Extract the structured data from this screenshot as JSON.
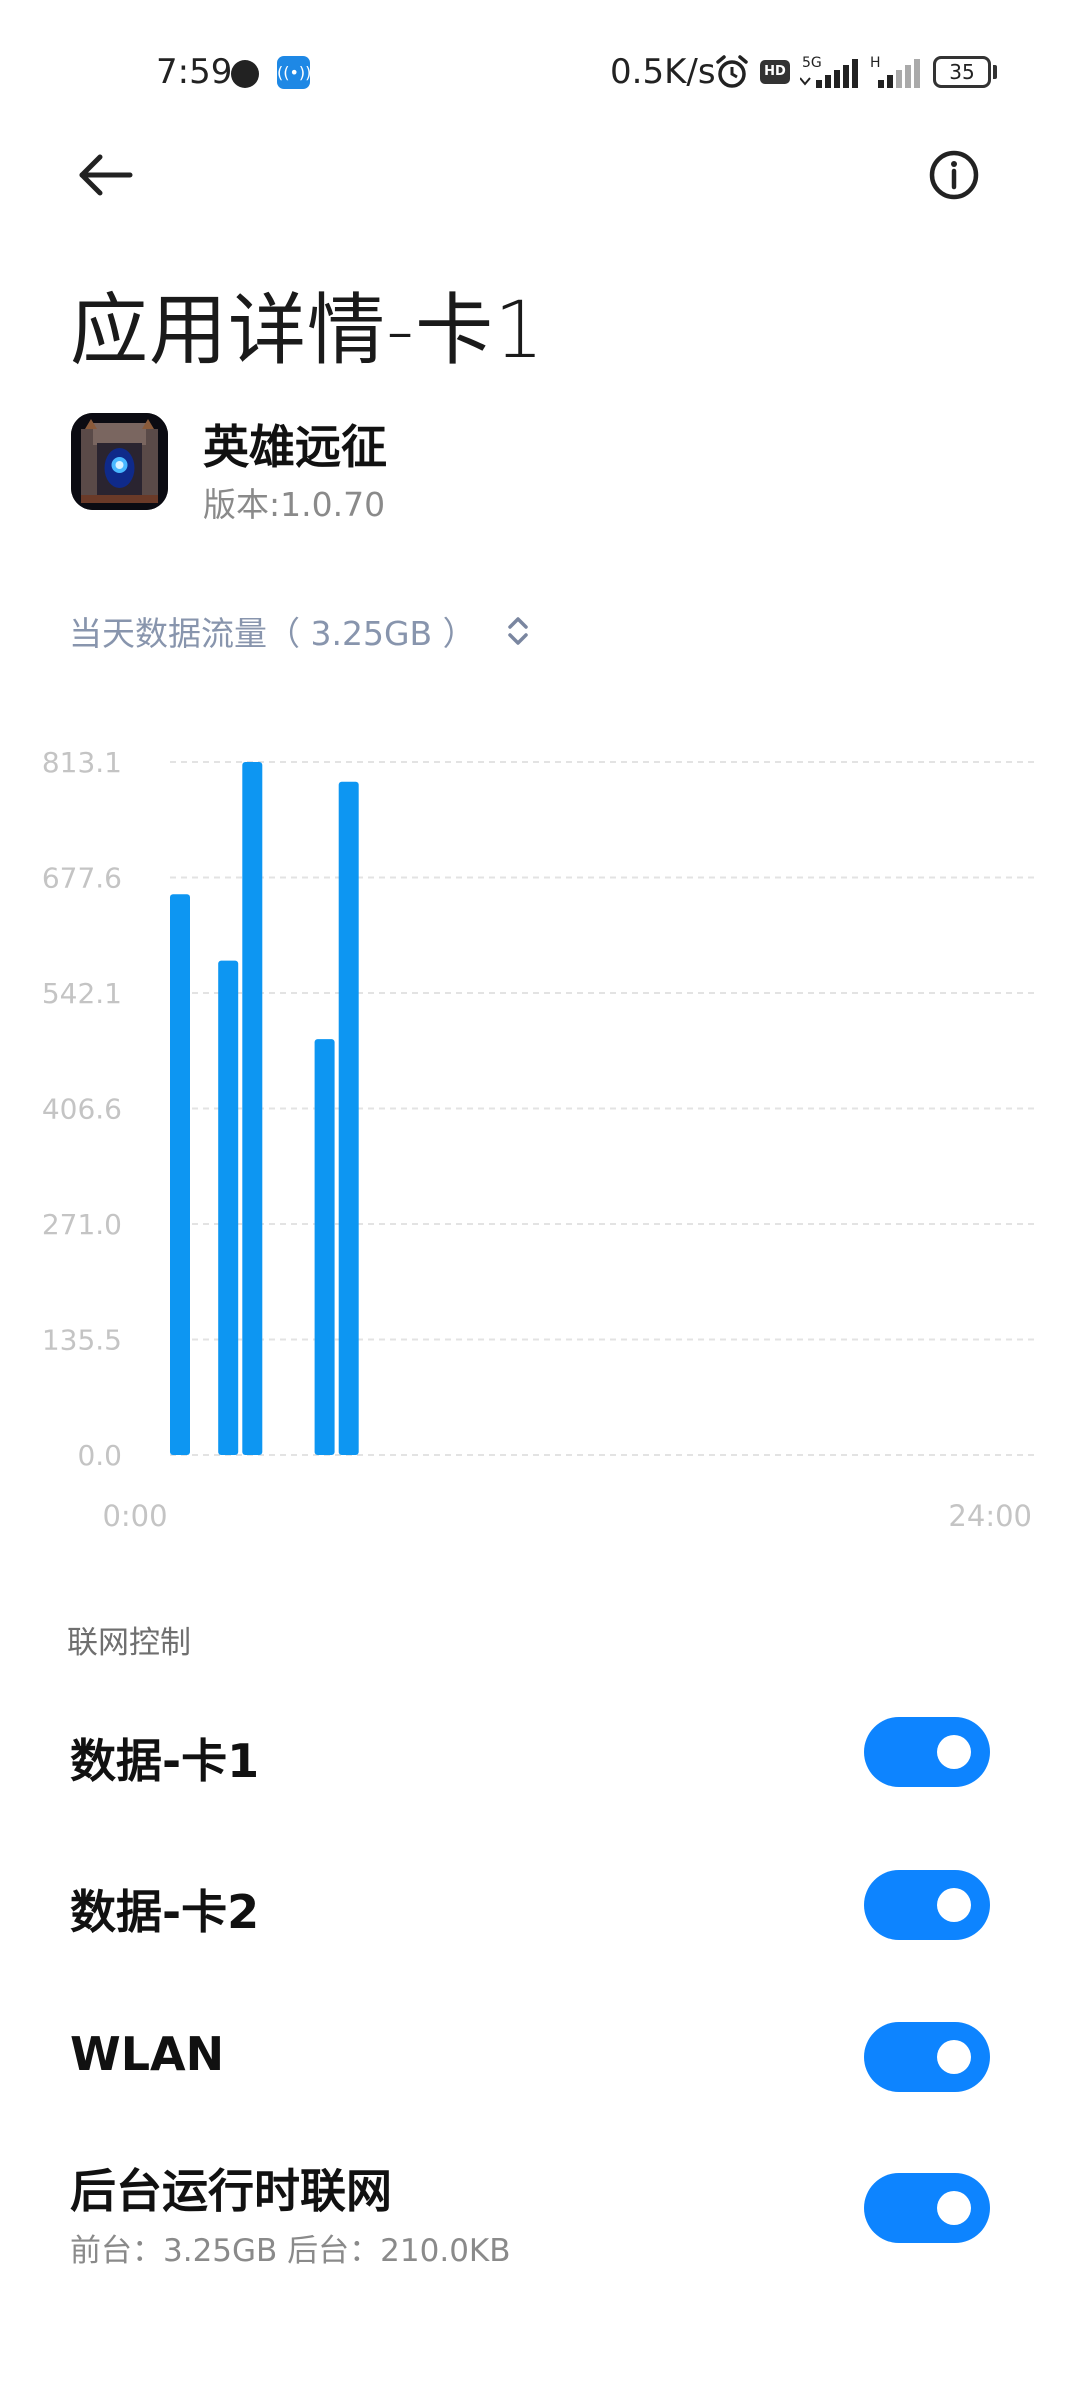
{
  "status_bar": {
    "time": "7:59",
    "net_speed": "0.5K/s",
    "hd_badge": "HD",
    "signal_1_label": "5G",
    "signal_2_label": "H",
    "battery": "35",
    "icons": [
      "clock-dot-icon",
      "app-notification-icon",
      "alarm-icon",
      "hd-icon",
      "signal-5g-icon",
      "signal-h-icon",
      "battery-icon"
    ]
  },
  "header": {
    "back_icon": "arrow-left-icon",
    "info_icon": "info-circle-icon"
  },
  "page": {
    "title": "应用详情-卡1"
  },
  "app": {
    "name": "英雄远征",
    "version": "版本:1.0.70"
  },
  "usage": {
    "selector_label": "当天数据流量（ 3.25GB ）",
    "selector_icon": "chevron-up-down-icon"
  },
  "chart_data": {
    "type": "bar",
    "y_ticks": [
      "813.1",
      "677.6",
      "542.1",
      "406.6",
      "271.0",
      "135.5",
      "0.0"
    ],
    "ylim": [
      0,
      813.1
    ],
    "x_ticks": [
      "0:00",
      "24:00"
    ],
    "bar_color": "#0d96f2",
    "hours": [
      0,
      1,
      2,
      3,
      4,
      5,
      6,
      7,
      8,
      9,
      10,
      11,
      12,
      13,
      14,
      15,
      16,
      17,
      18,
      19,
      20,
      21,
      22,
      23
    ],
    "values": [
      658,
      0,
      580,
      813.1,
      0,
      0,
      488,
      790,
      0,
      0,
      0,
      0,
      0,
      0,
      0,
      0,
      0,
      0,
      0,
      0,
      0,
      0,
      0,
      0
    ]
  },
  "network_control": {
    "section_title": "联网控制",
    "items": [
      {
        "label": "数据-卡1",
        "enabled": true
      },
      {
        "label": "数据-卡2",
        "enabled": true
      },
      {
        "label": "WLAN",
        "enabled": true
      },
      {
        "label": "后台运行时联网",
        "sublabel": "前台：3.25GB  后台：210.0KB",
        "enabled": true
      }
    ]
  },
  "colors": {
    "accent": "#0d84ff",
    "chart_bar": "#0d96f2",
    "selector_text": "#8895ad"
  }
}
